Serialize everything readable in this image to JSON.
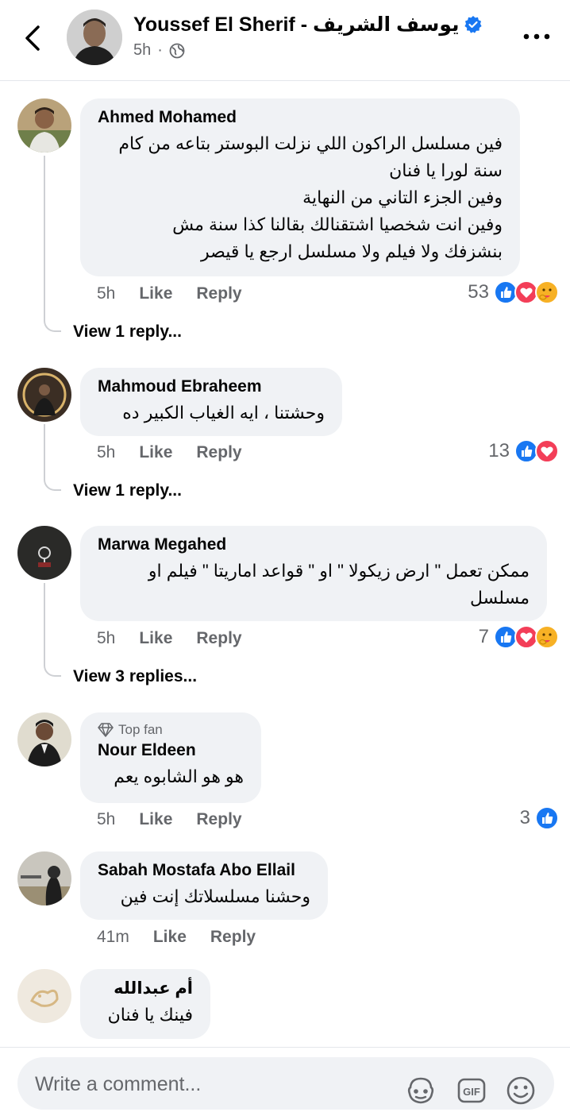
{
  "header": {
    "author": "Youssef El Sherif - يوسف الشريف",
    "time": "5h",
    "separator": "·"
  },
  "comments": [
    {
      "name": "Ahmed Mohamed",
      "text_lines": [
        "فين مسلسل الراكون اللي نزلت البوستر بتاعه من كام",
        "سنة لورا يا فنان",
        "وفين الجزء التاني من النهاية",
        "وفين انت شخصيا اشتقنالك بقالنا كذا سنة مش",
        "بنشزفك ولا فيلم ولا مسلسل ارجع يا  قيصر"
      ],
      "time": "5h",
      "like": "Like",
      "reply": "Reply",
      "reaction_count": "53",
      "reactions": [
        "like-icon",
        "love-icon",
        "care-icon"
      ],
      "view_replies": "View 1 reply..."
    },
    {
      "name": "Mahmoud Ebraheem",
      "text_lines": [
        "وحشتنا ، ايه الغياب الكبير ده"
      ],
      "time": "5h",
      "like": "Like",
      "reply": "Reply",
      "reaction_count": "13",
      "reactions": [
        "like-icon",
        "love-icon"
      ],
      "view_replies": "View 1 reply..."
    },
    {
      "name": "Marwa Megahed",
      "text_lines": [
        "ممكن تعمل \" ارض زيكولا \" او \" قواعد اماريتا \" فيلم او",
        "مسلسل"
      ],
      "time": "5h",
      "like": "Like",
      "reply": "Reply",
      "reaction_count": "7",
      "reactions": [
        "like-icon",
        "love-icon",
        "care-icon"
      ],
      "view_replies": "View 3 replies..."
    },
    {
      "badge": "Top fan",
      "name": "Nour Eldeen",
      "text_lines": [
        "هو هو الشابوه يعم"
      ],
      "time": "5h",
      "like": "Like",
      "reply": "Reply",
      "reaction_count": "3",
      "reactions": [
        "like-icon"
      ]
    },
    {
      "name": "Sabah Mostafa Abo Ellail",
      "text_lines": [
        "وحشنا مسلسلاتك إنت فين"
      ],
      "time": "41m",
      "like": "Like",
      "reply": "Reply"
    },
    {
      "name": "أم عبدالله",
      "text_lines": [
        "فينك يا فنان"
      ]
    }
  ],
  "footer": {
    "placeholder": "Write a comment..."
  },
  "colors": {
    "bubble": "#f0f2f5",
    "like_blue": "#1877f2",
    "love_red": "#f33e58",
    "verified_blue": "#1877f2",
    "secondary_text": "#65676b"
  }
}
